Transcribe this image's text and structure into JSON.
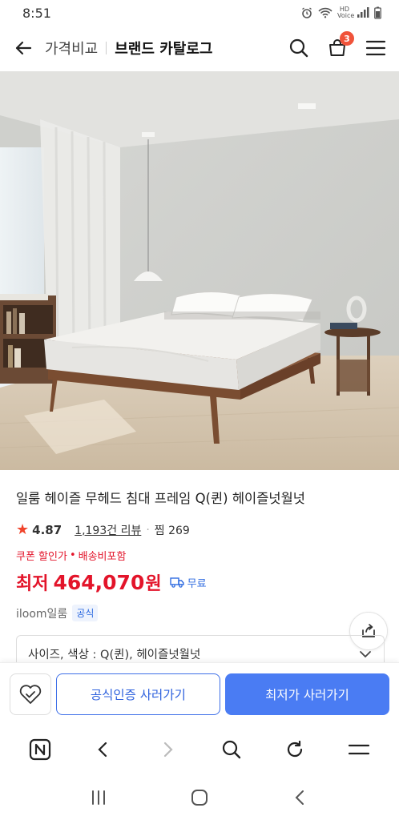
{
  "status": {
    "time": "8:51",
    "voice_label": "HD Voice"
  },
  "header": {
    "back_icon": "arrow-left-icon",
    "prev_crumb": "가격비교",
    "current_crumb": "브랜드 카탈로그",
    "cart_count": "3"
  },
  "product": {
    "title": "일룸 헤이즐 무헤드 침대 프레임 Q(퀸) 헤이즐넛월넛",
    "rating": "4.87",
    "reviews": "1,193건 리뷰",
    "wish": "찜 269",
    "coupon": "쿠폰 할인가",
    "shipping_tag": "배송비포함",
    "price_label": "최저",
    "price": "464,070",
    "price_unit": "원",
    "ship_label": "무료",
    "seller": "iloom일룸",
    "official_badge": "공식",
    "option_text_prefix": "사이즈, 색상 : ",
    "option_text_value": "Q(퀸), 헤이즐넛월넛"
  },
  "buybar": {
    "official_button": "공식인증 사러가기",
    "lowest_button": "최저가 사러가기"
  },
  "colors": {
    "accent_red": "#e3142a",
    "accent_blue": "#4a7cf3",
    "badge": "#f0533a"
  }
}
